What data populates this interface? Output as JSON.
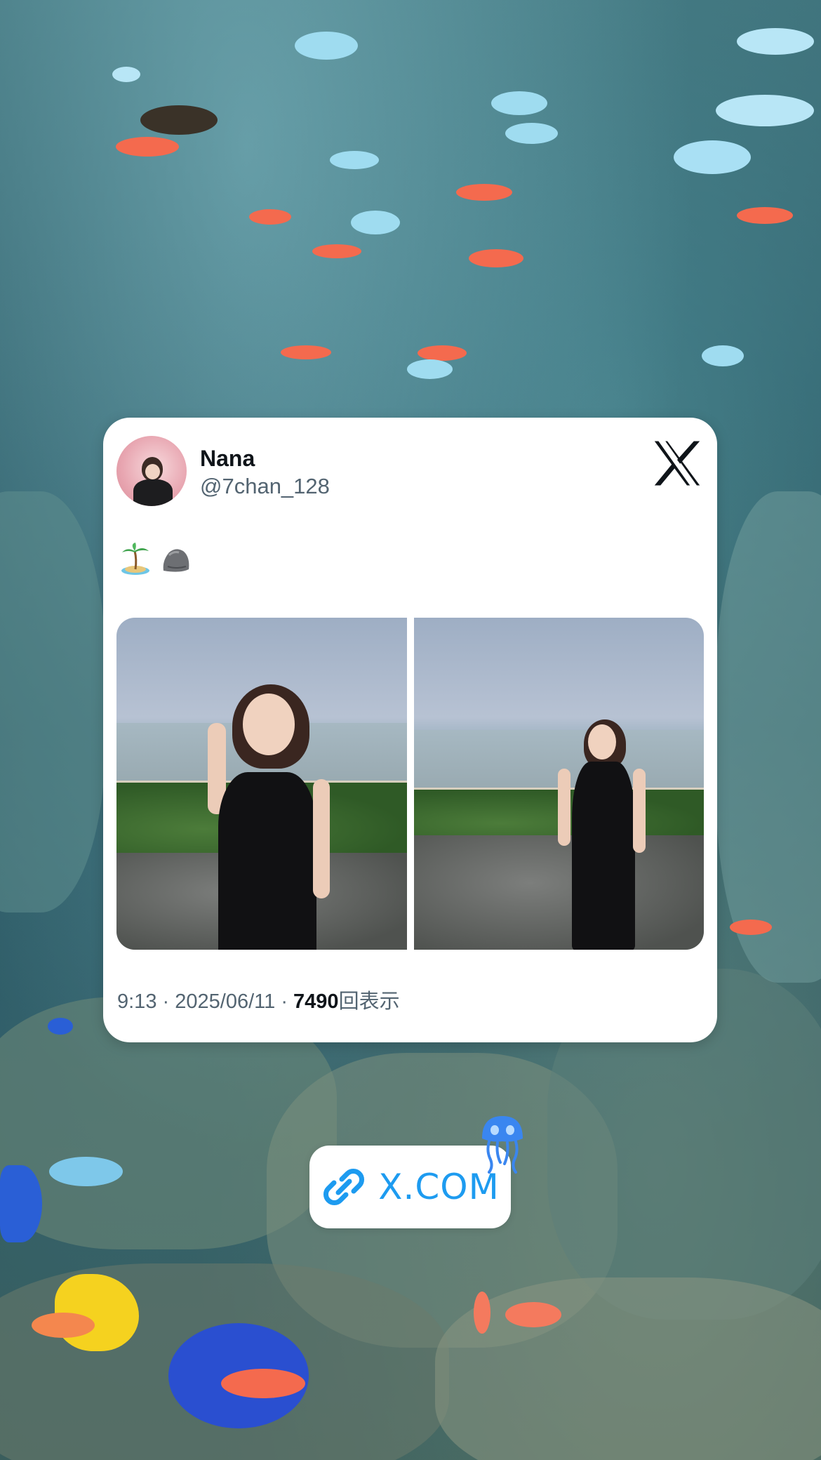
{
  "background": {
    "description_colors": {
      "water": "#2f5f6a",
      "fish_blue": "#8fd6f0",
      "fish_orange": "#f46a4e",
      "fish_yellow": "#f5d21f",
      "fish_royal_blue": "#2a4fd0"
    }
  },
  "post": {
    "author_name": "Nana",
    "author_handle": "@7chan_128",
    "brand_icon": "x-logo-icon",
    "body_emojis": [
      "palm-tree-island-icon",
      "rock-icon"
    ],
    "photos": [
      {
        "icon": "photo-woman-black-dress-beach-standing"
      },
      {
        "icon": "photo-woman-black-dress-beach-sitting"
      }
    ],
    "time": "9:13",
    "separator": "·",
    "date": "2025/06/11",
    "views_count": "7490",
    "views_label": "回表示"
  },
  "link_sticker": {
    "icon": "link-icon",
    "label": "X.COM",
    "color": "#1d9bf0"
  },
  "decorations": {
    "sticker_icon": "jellyfish-icon"
  }
}
